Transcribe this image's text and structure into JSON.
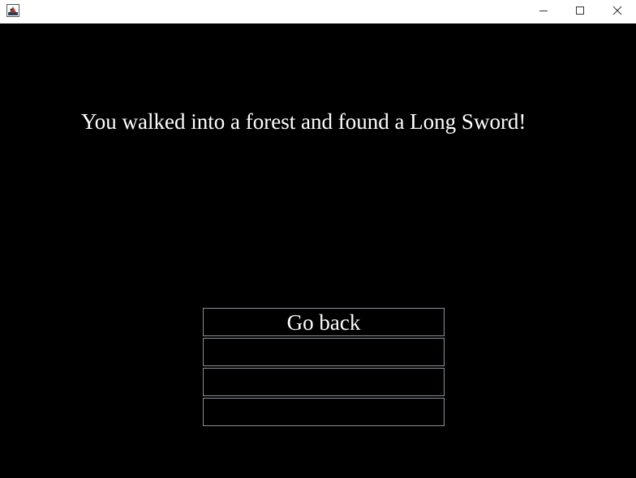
{
  "window": {
    "icon": "java-app-icon",
    "controls": {
      "minimize": "minimize-icon",
      "maximize": "maximize-icon",
      "close": "close-icon"
    }
  },
  "game": {
    "message": "You walked into a forest and found a Long Sword!",
    "choices": [
      "Go back",
      "",
      "",
      ""
    ]
  },
  "colors": {
    "background": "#000000",
    "text": "#ffffff",
    "button_border": "#8a8f98",
    "titlebar": "#ffffff"
  }
}
